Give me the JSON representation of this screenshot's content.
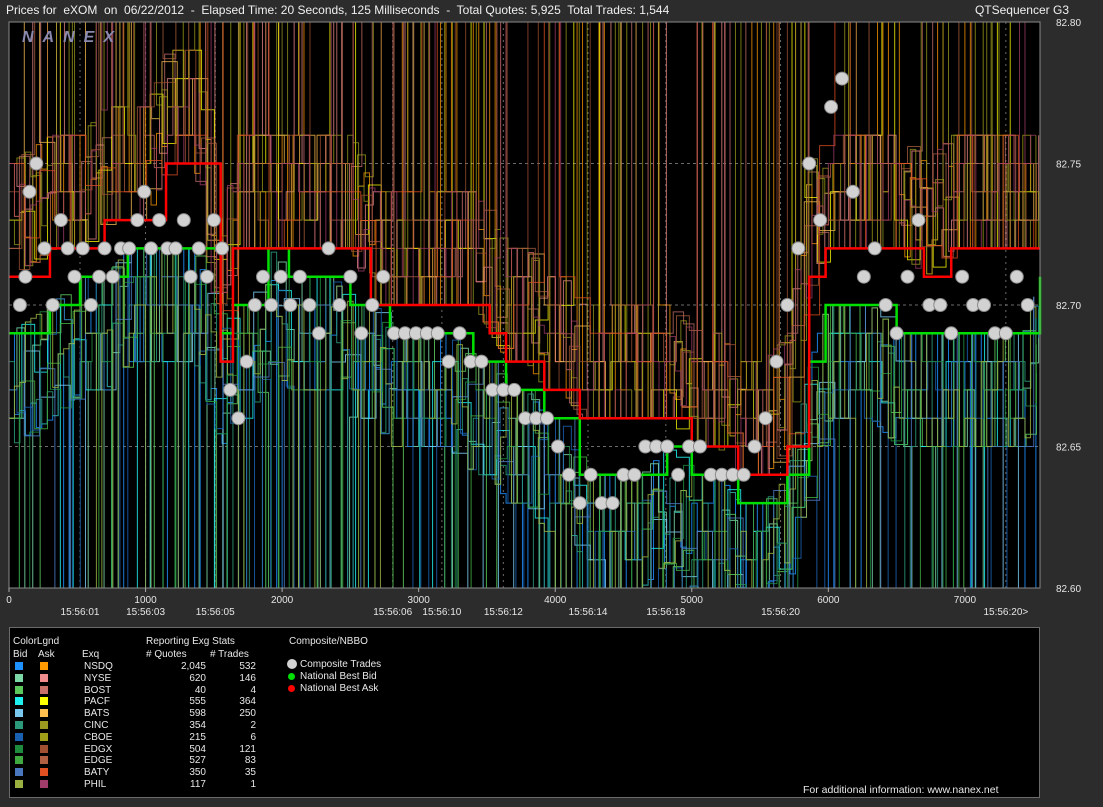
{
  "header": {
    "left_title": "Prices for  eXOM  on  06/22/2012  -  Elapsed Time: 20 Seconds, 125 Milliseconds  -  Total Quotes: 5,925  Total Trades: 1,544",
    "right_title": "QTSequencer G3"
  },
  "watermark": "NANEX",
  "colors": {
    "background": "#000000",
    "frame": "#2c2c2c",
    "composite_trade": "#d2d2d2",
    "national_best_bid": "#00e000",
    "national_best_ask": "#ff0000",
    "grid": "#6b6b6b"
  },
  "chart_data": {
    "type": "line",
    "title": "Prices for eXOM on 06/22/2012",
    "ylim": [
      82.6,
      82.8
    ],
    "xlim": [
      0,
      7550
    ],
    "y_ticks": [
      "82.80",
      "82.75",
      "82.70",
      "82.65",
      "82.60"
    ],
    "y_tick_values": [
      82.8,
      82.75,
      82.7,
      82.65,
      82.6
    ],
    "x_ticks": [
      "0",
      "1000",
      "2000",
      "3000",
      "4000",
      "5000",
      "6000",
      "7000"
    ],
    "x_tick_values": [
      0,
      1000,
      2000,
      3000,
      4000,
      5000,
      6000,
      7000
    ],
    "time_labels": [
      {
        "text": "15:56:01",
        "x": 520
      },
      {
        "text": "15:56:03",
        "x": 1000
      },
      {
        "text": "15:56:05",
        "x": 1510
      },
      {
        "text": "15:56:06",
        "x": 2810
      },
      {
        "text": "15:56:10",
        "x": 3170
      },
      {
        "text": "15:56:12",
        "x": 3620
      },
      {
        "text": "15:56:14",
        "x": 4240
      },
      {
        "text": "15:56:18",
        "x": 4810
      },
      {
        "text": "15:56:20",
        "x": 5650
      },
      {
        "text": "15:56:20>",
        "x": 7300
      }
    ],
    "grid": true,
    "series": [
      {
        "name": "National Best Bid",
        "x": [
          0,
          300,
          520,
          700,
          870,
          1000,
          1150,
          1350,
          1550,
          1640,
          1760,
          1900,
          2050,
          2200,
          2350,
          2500,
          2650,
          2790,
          3000,
          3200,
          3400,
          3520,
          3640,
          3780,
          3920,
          4040,
          4180,
          4300,
          4460,
          4620,
          4820,
          5000,
          5180,
          5340,
          5520,
          5700,
          5860,
          5980,
          6100,
          6300,
          6500,
          6700,
          6900,
          7100,
          7300,
          7420,
          7550
        ],
        "values": [
          82.69,
          82.7,
          82.71,
          82.71,
          82.72,
          82.72,
          82.72,
          82.72,
          82.69,
          82.7,
          82.7,
          82.72,
          82.71,
          82.71,
          82.71,
          82.7,
          82.7,
          82.69,
          82.69,
          82.69,
          82.68,
          82.68,
          82.67,
          82.67,
          82.66,
          82.66,
          82.64,
          82.64,
          82.64,
          82.64,
          82.65,
          82.64,
          82.64,
          82.63,
          82.63,
          82.64,
          82.68,
          82.7,
          82.7,
          82.7,
          82.69,
          82.69,
          82.69,
          82.69,
          82.69,
          82.69,
          82.71
        ]
      },
      {
        "name": "National Best Ask",
        "x": [
          0,
          300,
          520,
          700,
          870,
          1000,
          1150,
          1350,
          1550,
          1640,
          1760,
          1900,
          2050,
          2200,
          2350,
          2500,
          2650,
          2790,
          3000,
          3200,
          3400,
          3520,
          3640,
          3780,
          3920,
          4040,
          4180,
          4300,
          4460,
          4620,
          4820,
          5000,
          5180,
          5340,
          5520,
          5700,
          5860,
          5980,
          6100,
          6300,
          6500,
          6700,
          6900,
          7100,
          7300,
          7420,
          7550
        ],
        "values": [
          82.71,
          82.72,
          82.72,
          82.73,
          82.73,
          82.73,
          82.75,
          82.75,
          82.68,
          82.72,
          82.72,
          82.72,
          82.72,
          82.72,
          82.72,
          82.72,
          82.7,
          82.7,
          82.7,
          82.7,
          82.7,
          82.69,
          82.68,
          82.68,
          82.67,
          82.67,
          82.66,
          82.66,
          82.66,
          82.66,
          82.66,
          82.65,
          82.65,
          82.64,
          82.64,
          82.65,
          82.71,
          82.72,
          82.72,
          82.72,
          82.72,
          82.71,
          82.72,
          82.72,
          82.72,
          82.72,
          82.72
        ]
      },
      {
        "name": "Composite Trades",
        "x": [
          80,
          120,
          150,
          200,
          260,
          320,
          380,
          430,
          480,
          540,
          600,
          660,
          700,
          760,
          820,
          880,
          940,
          990,
          1040,
          1100,
          1160,
          1220,
          1280,
          1330,
          1390,
          1450,
          1500,
          1560,
          1620,
          1680,
          1740,
          1800,
          1860,
          1920,
          1990,
          2060,
          2130,
          2200,
          2270,
          2340,
          2420,
          2500,
          2580,
          2660,
          2740,
          2820,
          2900,
          2980,
          3060,
          3140,
          3220,
          3300,
          3380,
          3460,
          3540,
          3620,
          3700,
          3780,
          3860,
          3940,
          4020,
          4100,
          4180,
          4260,
          4340,
          4420,
          4500,
          4580,
          4660,
          4740,
          4820,
          4900,
          4980,
          5060,
          5140,
          5220,
          5300,
          5380,
          5460,
          5540,
          5620,
          5700,
          5780,
          5860,
          5940,
          6020,
          6100,
          6180,
          6260,
          6340,
          6420,
          6500,
          6580,
          6660,
          6740,
          6820,
          6900,
          6980,
          7060,
          7140,
          7220,
          7300,
          7380,
          7460
        ],
        "values": [
          82.7,
          82.71,
          82.74,
          82.75,
          82.72,
          82.7,
          82.73,
          82.72,
          82.71,
          82.72,
          82.7,
          82.71,
          82.72,
          82.71,
          82.72,
          82.72,
          82.73,
          82.74,
          82.72,
          82.73,
          82.72,
          82.72,
          82.73,
          82.71,
          82.72,
          82.71,
          82.73,
          82.72,
          82.67,
          82.66,
          82.68,
          82.7,
          82.71,
          82.7,
          82.71,
          82.7,
          82.71,
          82.7,
          82.69,
          82.72,
          82.7,
          82.71,
          82.69,
          82.7,
          82.71,
          82.69,
          82.69,
          82.69,
          82.69,
          82.69,
          82.68,
          82.69,
          82.68,
          82.68,
          82.67,
          82.67,
          82.67,
          82.66,
          82.66,
          82.66,
          82.65,
          82.64,
          82.63,
          82.64,
          82.63,
          82.63,
          82.64,
          82.64,
          82.65,
          82.65,
          82.65,
          82.64,
          82.65,
          82.65,
          82.64,
          82.64,
          82.64,
          82.64,
          82.65,
          82.66,
          82.68,
          82.7,
          82.72,
          82.75,
          82.73,
          82.77,
          82.78,
          82.74,
          82.71,
          82.72,
          82.7,
          82.69,
          82.71,
          82.73,
          82.7,
          82.7,
          82.69,
          82.71,
          82.7,
          82.7,
          82.69,
          82.69,
          82.71,
          82.7
        ]
      }
    ]
  },
  "legend": {
    "color_legend_title": "ColorLgnd",
    "bid_header": "Bid",
    "ask_header": "Ask",
    "exch_header": "Exq",
    "stats_title": "Reporting Exg Stats",
    "quotes_header": "# Quotes",
    "trades_header": "# Trades",
    "composite_title": "Composite/NBBO",
    "markers": [
      {
        "label": "Composite Trades",
        "color": "#d2d2d2"
      },
      {
        "label": "National Best Bid",
        "color": "#00e000"
      },
      {
        "label": "National Best Ask",
        "color": "#ff0000"
      }
    ],
    "exchanges": [
      {
        "name": "NSDQ",
        "quotes": "2,045",
        "trades": "532",
        "bid_color": "#1e90ff",
        "ask_color": "#ff9a00"
      },
      {
        "name": "NYSE",
        "quotes": "620",
        "trades": "146",
        "bid_color": "#7dd8a8",
        "ask_color": "#f08c8c"
      },
      {
        "name": "BOST",
        "quotes": "40",
        "trades": "4",
        "bid_color": "#5ac85a",
        "ask_color": "#c8706a"
      },
      {
        "name": "PACF",
        "quotes": "555",
        "trades": "364",
        "bid_color": "#1ef0f0",
        "ask_color": "#ffff00"
      },
      {
        "name": "BATS",
        "quotes": "598",
        "trades": "250",
        "bid_color": "#78c8f0",
        "ask_color": "#ffc050"
      },
      {
        "name": "CINC",
        "quotes": "354",
        "trades": "2",
        "bid_color": "#2a9a7a",
        "ask_color": "#9a9a20"
      },
      {
        "name": "CBOE",
        "quotes": "215",
        "trades": "6",
        "bid_color": "#1a60b0",
        "ask_color": "#a0a018"
      },
      {
        "name": "EDGX",
        "quotes": "504",
        "trades": "121",
        "bid_color": "#1e8a3c",
        "ask_color": "#a05030"
      },
      {
        "name": "EDGE",
        "quotes": "527",
        "trades": "83",
        "bid_color": "#40a840",
        "ask_color": "#b06040"
      },
      {
        "name": "BATY",
        "quotes": "350",
        "trades": "35",
        "bid_color": "#4a78c0",
        "ask_color": "#e05020"
      },
      {
        "name": "PHIL",
        "quotes": "117",
        "trades": "1",
        "bid_color": "#9ab040",
        "ask_color": "#a03c6a"
      }
    ],
    "footer": "For additional information: www.nanex.net"
  }
}
